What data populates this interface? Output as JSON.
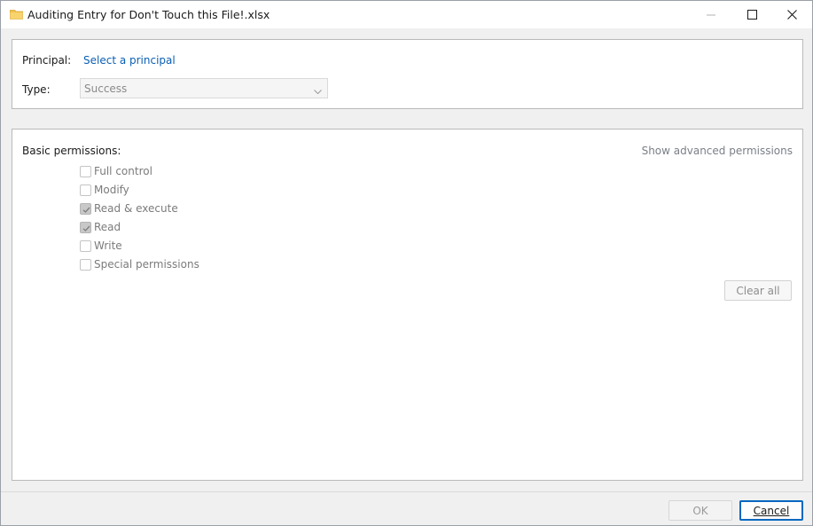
{
  "window": {
    "title": "Auditing Entry for Don't Touch this File!.xlsx",
    "title_icon": "folder-icon",
    "controls": [
      "minimize-icon",
      "maximize-icon",
      "close-icon"
    ]
  },
  "principal": {
    "label": "Principal:",
    "link": "Select a principal"
  },
  "type": {
    "label": "Type:",
    "value": "Success"
  },
  "permissions": {
    "heading": "Basic permissions:",
    "advanced_link": "Show advanced permissions",
    "items": [
      {
        "label": "Full control",
        "checked": false
      },
      {
        "label": "Modify",
        "checked": false
      },
      {
        "label": "Read & execute",
        "checked": true
      },
      {
        "label": "Read",
        "checked": true
      },
      {
        "label": "Write",
        "checked": false
      },
      {
        "label": "Special permissions",
        "checked": false
      }
    ],
    "clear_all": "Clear all"
  },
  "footer": {
    "ok": "OK",
    "cancel": "Cancel"
  },
  "colors": {
    "link": "#0a5fb4",
    "focus_border": "#0067c0",
    "folder": "#f2c14e"
  }
}
